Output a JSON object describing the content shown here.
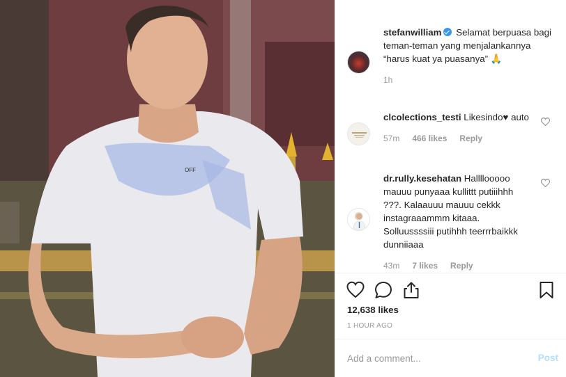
{
  "post": {
    "photo": "man-in-white-tshirt-photo",
    "author": "stefanwilliam",
    "verified": true,
    "caption_text": "Selamat berpuasa bagi teman-teman yang menjalankannya “harus kuat ya puasanya” 🙏",
    "caption_time": "1h",
    "likes_count": "12,638 likes",
    "time_ago": "1 HOUR AGO"
  },
  "comments": [
    {
      "username": "clcolections_testi",
      "text": "Likesindo♥ auto",
      "time": "57m",
      "likes": "466 likes",
      "reply_label": "Reply",
      "avatar": "brand-logo-avatar"
    },
    {
      "username": "dr.rully.kesehatan",
      "text": "Hallllooooo mauuu punyaaa kullittt putiiihhh ???. Kalaauuu mauuu cekkk instagraaammm kitaaa. Solluussssiii putihhh teerrrbaikkk dunniiaaa",
      "time": "43m",
      "likes": "7 likes",
      "reply_label": "Reply",
      "avatar": "doctor-avatar"
    }
  ],
  "add_comment": {
    "placeholder": "Add a comment...",
    "post_label": "Post"
  },
  "colors": {
    "text": "#262626",
    "muted": "#999999",
    "verified": "#3897f0",
    "post_disabled": "#b2dffc"
  },
  "icons": [
    "heart-icon",
    "comment-icon",
    "share-icon",
    "bookmark-icon",
    "verified-badge-icon"
  ]
}
